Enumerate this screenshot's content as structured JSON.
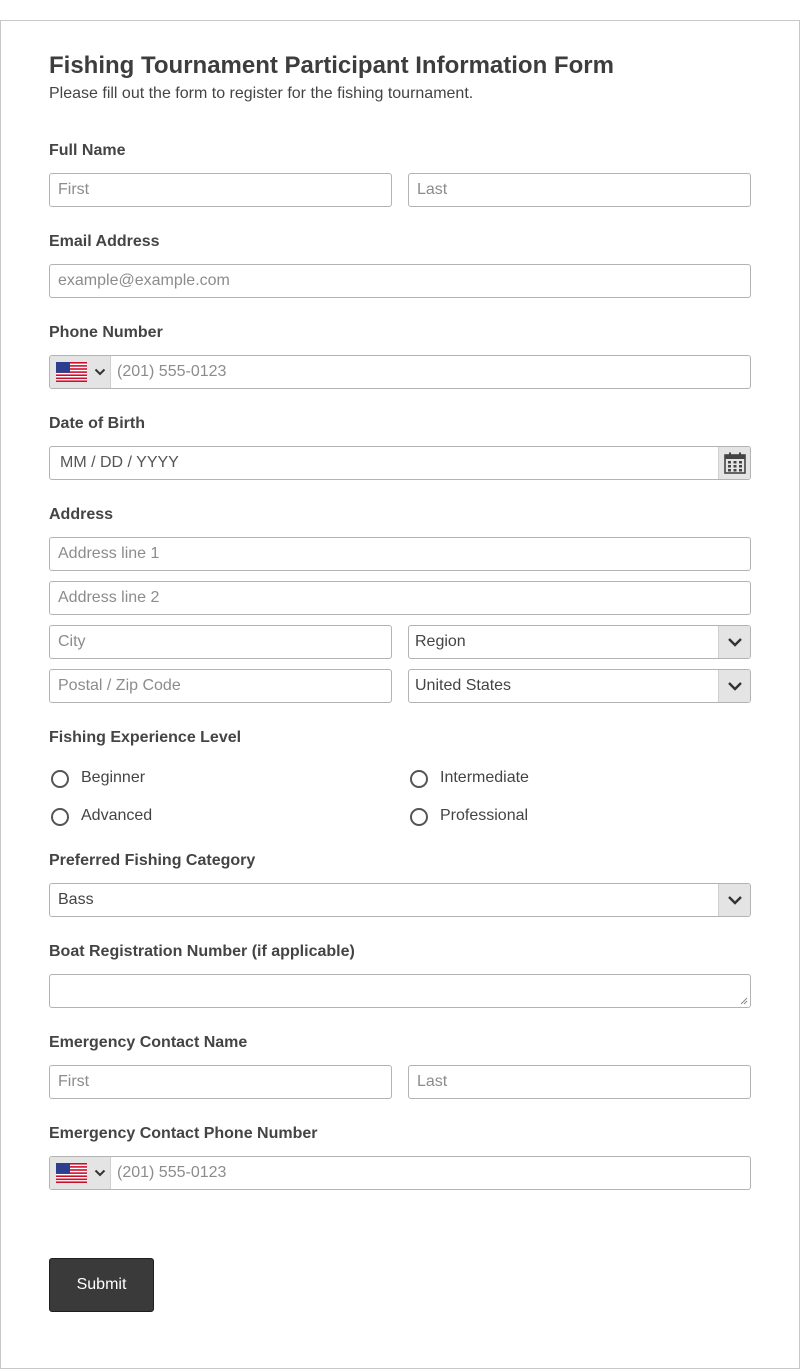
{
  "form": {
    "title": "Fishing Tournament Participant Information Form",
    "subtitle": "Please fill out the form to register for the fishing tournament."
  },
  "full_name": {
    "label": "Full Name",
    "first_placeholder": "First",
    "last_placeholder": "Last"
  },
  "email": {
    "label": "Email Address",
    "placeholder": "example@example.com"
  },
  "phone": {
    "label": "Phone Number",
    "placeholder": "(201) 555-0123",
    "country_icon": "us-flag-icon"
  },
  "dob": {
    "label": "Date of Birth",
    "placeholder": "MM / DD / YYYY",
    "icon": "calendar-icon"
  },
  "address": {
    "label": "Address",
    "line1_placeholder": "Address line 1",
    "line2_placeholder": "Address line 2",
    "city_placeholder": "City",
    "region_value": "Region",
    "postal_placeholder": "Postal / Zip Code",
    "country_value": "United States"
  },
  "experience": {
    "label": "Fishing Experience Level",
    "options": [
      "Beginner",
      "Intermediate",
      "Advanced",
      "Professional"
    ]
  },
  "category": {
    "label": "Preferred Fishing Category",
    "value": "Bass"
  },
  "boat": {
    "label": "Boat Registration Number (if applicable)"
  },
  "emergency_name": {
    "label": "Emergency Contact Name",
    "first_placeholder": "First",
    "last_placeholder": "Last"
  },
  "emergency_phone": {
    "label": "Emergency Contact Phone Number",
    "placeholder": "(201) 555-0123",
    "country_icon": "us-flag-icon"
  },
  "submit_label": "Submit",
  "colors": {
    "button_bg": "#3a3a3a",
    "border": "#b3b3b3",
    "addon_bg": "#e4e4e4"
  }
}
